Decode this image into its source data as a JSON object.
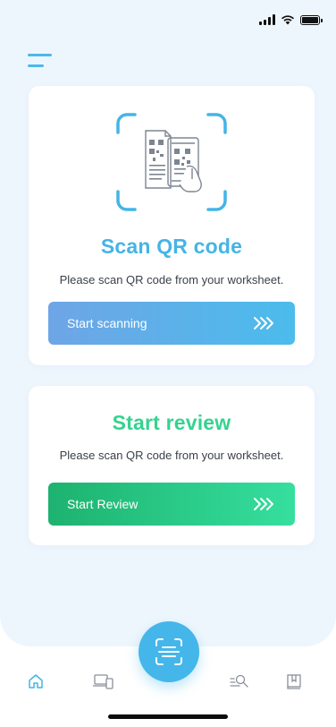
{
  "colors": {
    "accent_blue": "#45b4e6",
    "accent_green": "#34d38f",
    "background": "#eef6fd",
    "card": "#ffffff"
  },
  "status_bar": {
    "icons": [
      "signal-icon",
      "wifi-icon",
      "battery-icon"
    ]
  },
  "header": {
    "menu_icon": "hamburger-menu-icon"
  },
  "scan_card": {
    "illustration": "qr-scan-illustration",
    "title": "Scan QR code",
    "description": "Please scan QR code from your worksheet.",
    "button_label": "Start scanning",
    "button_icon": "triple-chevron-right-icon"
  },
  "review_card": {
    "title": "Start review",
    "description": "Please scan QR code from your worksheet.",
    "button_label": "Start Review",
    "button_icon": "triple-chevron-right-icon"
  },
  "fab": {
    "icon": "scan-icon"
  },
  "bottom_nav": {
    "items": [
      "home-icon",
      "devices-icon",
      "scan-icon",
      "search-docs-icon",
      "bookmark-book-icon"
    ],
    "active": "home-icon"
  }
}
